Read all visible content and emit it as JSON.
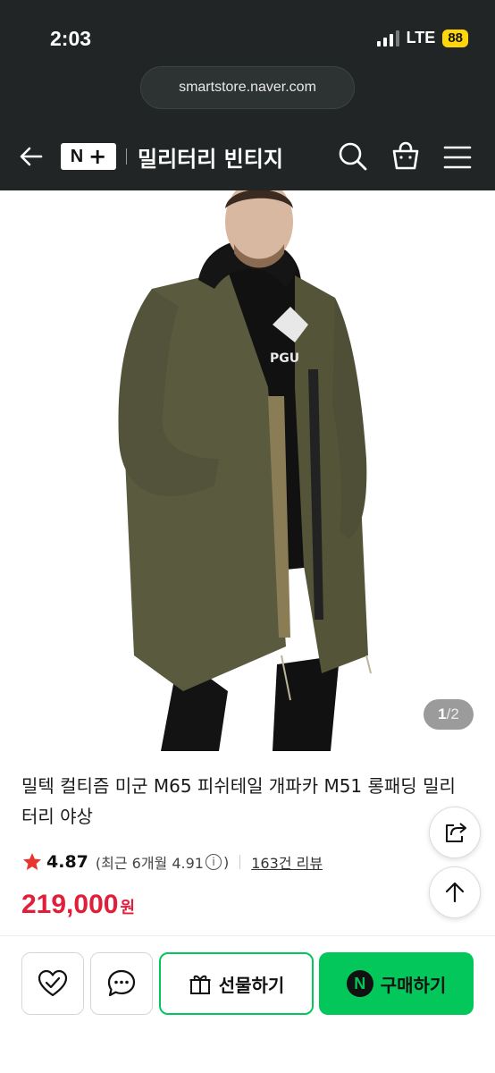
{
  "status_bar": {
    "time": "2:03",
    "network": "LTE",
    "battery": "88"
  },
  "browser": {
    "url": "smartstore.naver.com"
  },
  "header": {
    "logo_n": "N",
    "logo_plus": "+",
    "store_name": "밀리터리 빈티지"
  },
  "gallery": {
    "current": "1",
    "total": "/2"
  },
  "product": {
    "title": "밀텍 컬티즘 미군 M65 피쉬테일 개파카 M51 롱패딩 밀리터리 야상",
    "rating": "4.87",
    "recent_rating_label": "(최근 6개월 4.91",
    "recent_rating_close": ")",
    "info_glyph": "i",
    "review_link": "163건 리뷰",
    "price": "219,000",
    "price_unit": "원"
  },
  "actions": {
    "gift_label": "선물하기",
    "buy_label": "구매하기",
    "npay_glyph": "N"
  },
  "colors": {
    "naver_green": "#03c75a",
    "price_red": "#e0203a",
    "header_bg": "#212525",
    "star": "#e8352d"
  }
}
